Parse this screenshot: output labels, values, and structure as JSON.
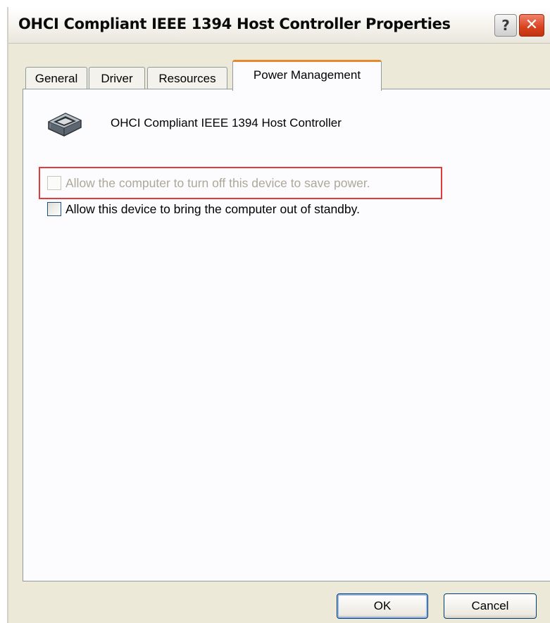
{
  "window": {
    "title": "OHCI Compliant IEEE 1394 Host Controller Properties",
    "help_label": "?",
    "close_label": "✕"
  },
  "tabs": [
    {
      "label": "General",
      "active": false
    },
    {
      "label": "Driver",
      "active": false
    },
    {
      "label": "Resources",
      "active": false
    },
    {
      "label": "Power Management",
      "active": true
    }
  ],
  "device": {
    "icon": "1394-port-icon",
    "name": "OHCI Compliant IEEE 1394 Host Controller"
  },
  "options": [
    {
      "label": "Allow the computer to turn off this device to save power.",
      "checked": false,
      "enabled": false,
      "highlighted": true
    },
    {
      "label": "Allow this device to bring the computer out of standby.",
      "checked": false,
      "enabled": true,
      "highlighted": false
    }
  ],
  "buttons": {
    "ok_label": "OK",
    "cancel_label": "Cancel"
  },
  "colors": {
    "active_tab_accent": "#e68b2c",
    "highlight": "#e23b3b",
    "close_button": "#d9411e"
  }
}
